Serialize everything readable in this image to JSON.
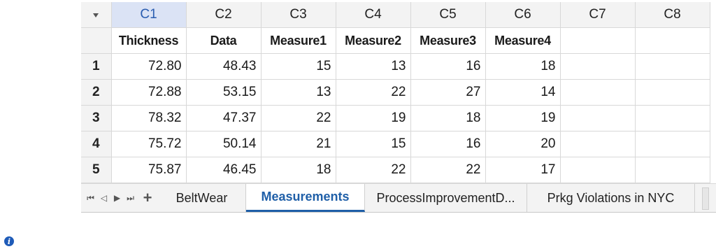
{
  "worksheet": {
    "corner_icon": "sort-down-arrow-icon",
    "columns": [
      "C1",
      "C2",
      "C3",
      "C4",
      "C5",
      "C6",
      "C7",
      "C8"
    ],
    "selected_column": "C1",
    "names": [
      "Thickness",
      "Data",
      "Measure1",
      "Measure2",
      "Measure3",
      "Measure4",
      "",
      ""
    ],
    "rows": [
      {
        "n": "1",
        "cells": [
          "72.80",
          "48.43",
          "15",
          "13",
          "16",
          "18"
        ]
      },
      {
        "n": "2",
        "cells": [
          "72.88",
          "53.15",
          "13",
          "22",
          "27",
          "14"
        ]
      },
      {
        "n": "3",
        "cells": [
          "78.32",
          "47.37",
          "22",
          "19",
          "18",
          "19"
        ]
      },
      {
        "n": "4",
        "cells": [
          "75.72",
          "50.14",
          "21",
          "15",
          "16",
          "20"
        ]
      },
      {
        "n": "5",
        "cells": [
          "75.87",
          "46.45",
          "18",
          "22",
          "22",
          "17"
        ]
      }
    ]
  },
  "tabs": {
    "nav_icons": [
      "first-sheet-icon",
      "prev-sheet-icon",
      "next-sheet-icon",
      "last-sheet-icon"
    ],
    "add_icon": "add-sheet-icon",
    "add_label": "+",
    "sheets": [
      {
        "label": "BeltWear",
        "active": false
      },
      {
        "label": "Measurements",
        "active": true
      },
      {
        "label": "ProcessImprovementD...",
        "active": false
      },
      {
        "label": "Prkg Violations in NYC",
        "active": false
      }
    ],
    "accent": "#1f5fa8"
  },
  "status": {
    "info_icon": "info-icon",
    "info_glyph": "i"
  }
}
